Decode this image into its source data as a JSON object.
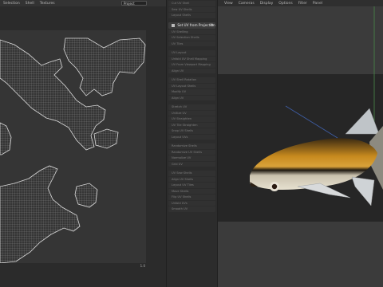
{
  "uv_editor": {
    "menu": [
      "Selection",
      "Shell",
      "Textures"
    ],
    "view_dropdown": "Project",
    "corner_label": "1.0"
  },
  "tool_panel": {
    "items_top": [
      "Cut UV Shell",
      "Sew UV Shells",
      "Layout Shells"
    ],
    "active_item": "Set UV from Projection",
    "items": [
      "UV Shelling",
      "UV Selection Shells",
      "UV Tiles",
      "UV Layout",
      "Unfold UV Shell Mapping",
      "UV From Viewport Mapping",
      "Align UV",
      "UV Shell Rotation",
      "UV Layout Shells",
      "Modify UV",
      "Align UV",
      "Stretch UV",
      "Unitize UV",
      "UV Straighten",
      "UV Tile Straighten",
      "Snap UV Shells",
      "Layout UVs",
      "Randomize Shells",
      "Randomize UV Shells",
      "Normalize UV",
      "Grid UV",
      "UV Sew Shells",
      "Align UV Shells",
      "Layout UV Tiles",
      "Move Shells",
      "Flip UV Shells",
      "Unfold UVs",
      "Smooth UV"
    ]
  },
  "viewport": {
    "menu": [
      "View",
      "Cameras",
      "Display",
      "Options",
      "Filter",
      "Panel"
    ]
  },
  "colors": {
    "fish_body": "#c78a1e",
    "fish_back": "#3b2a12",
    "fish_belly": "#e7e1d0",
    "uv_wire": "#d9d9d9"
  }
}
